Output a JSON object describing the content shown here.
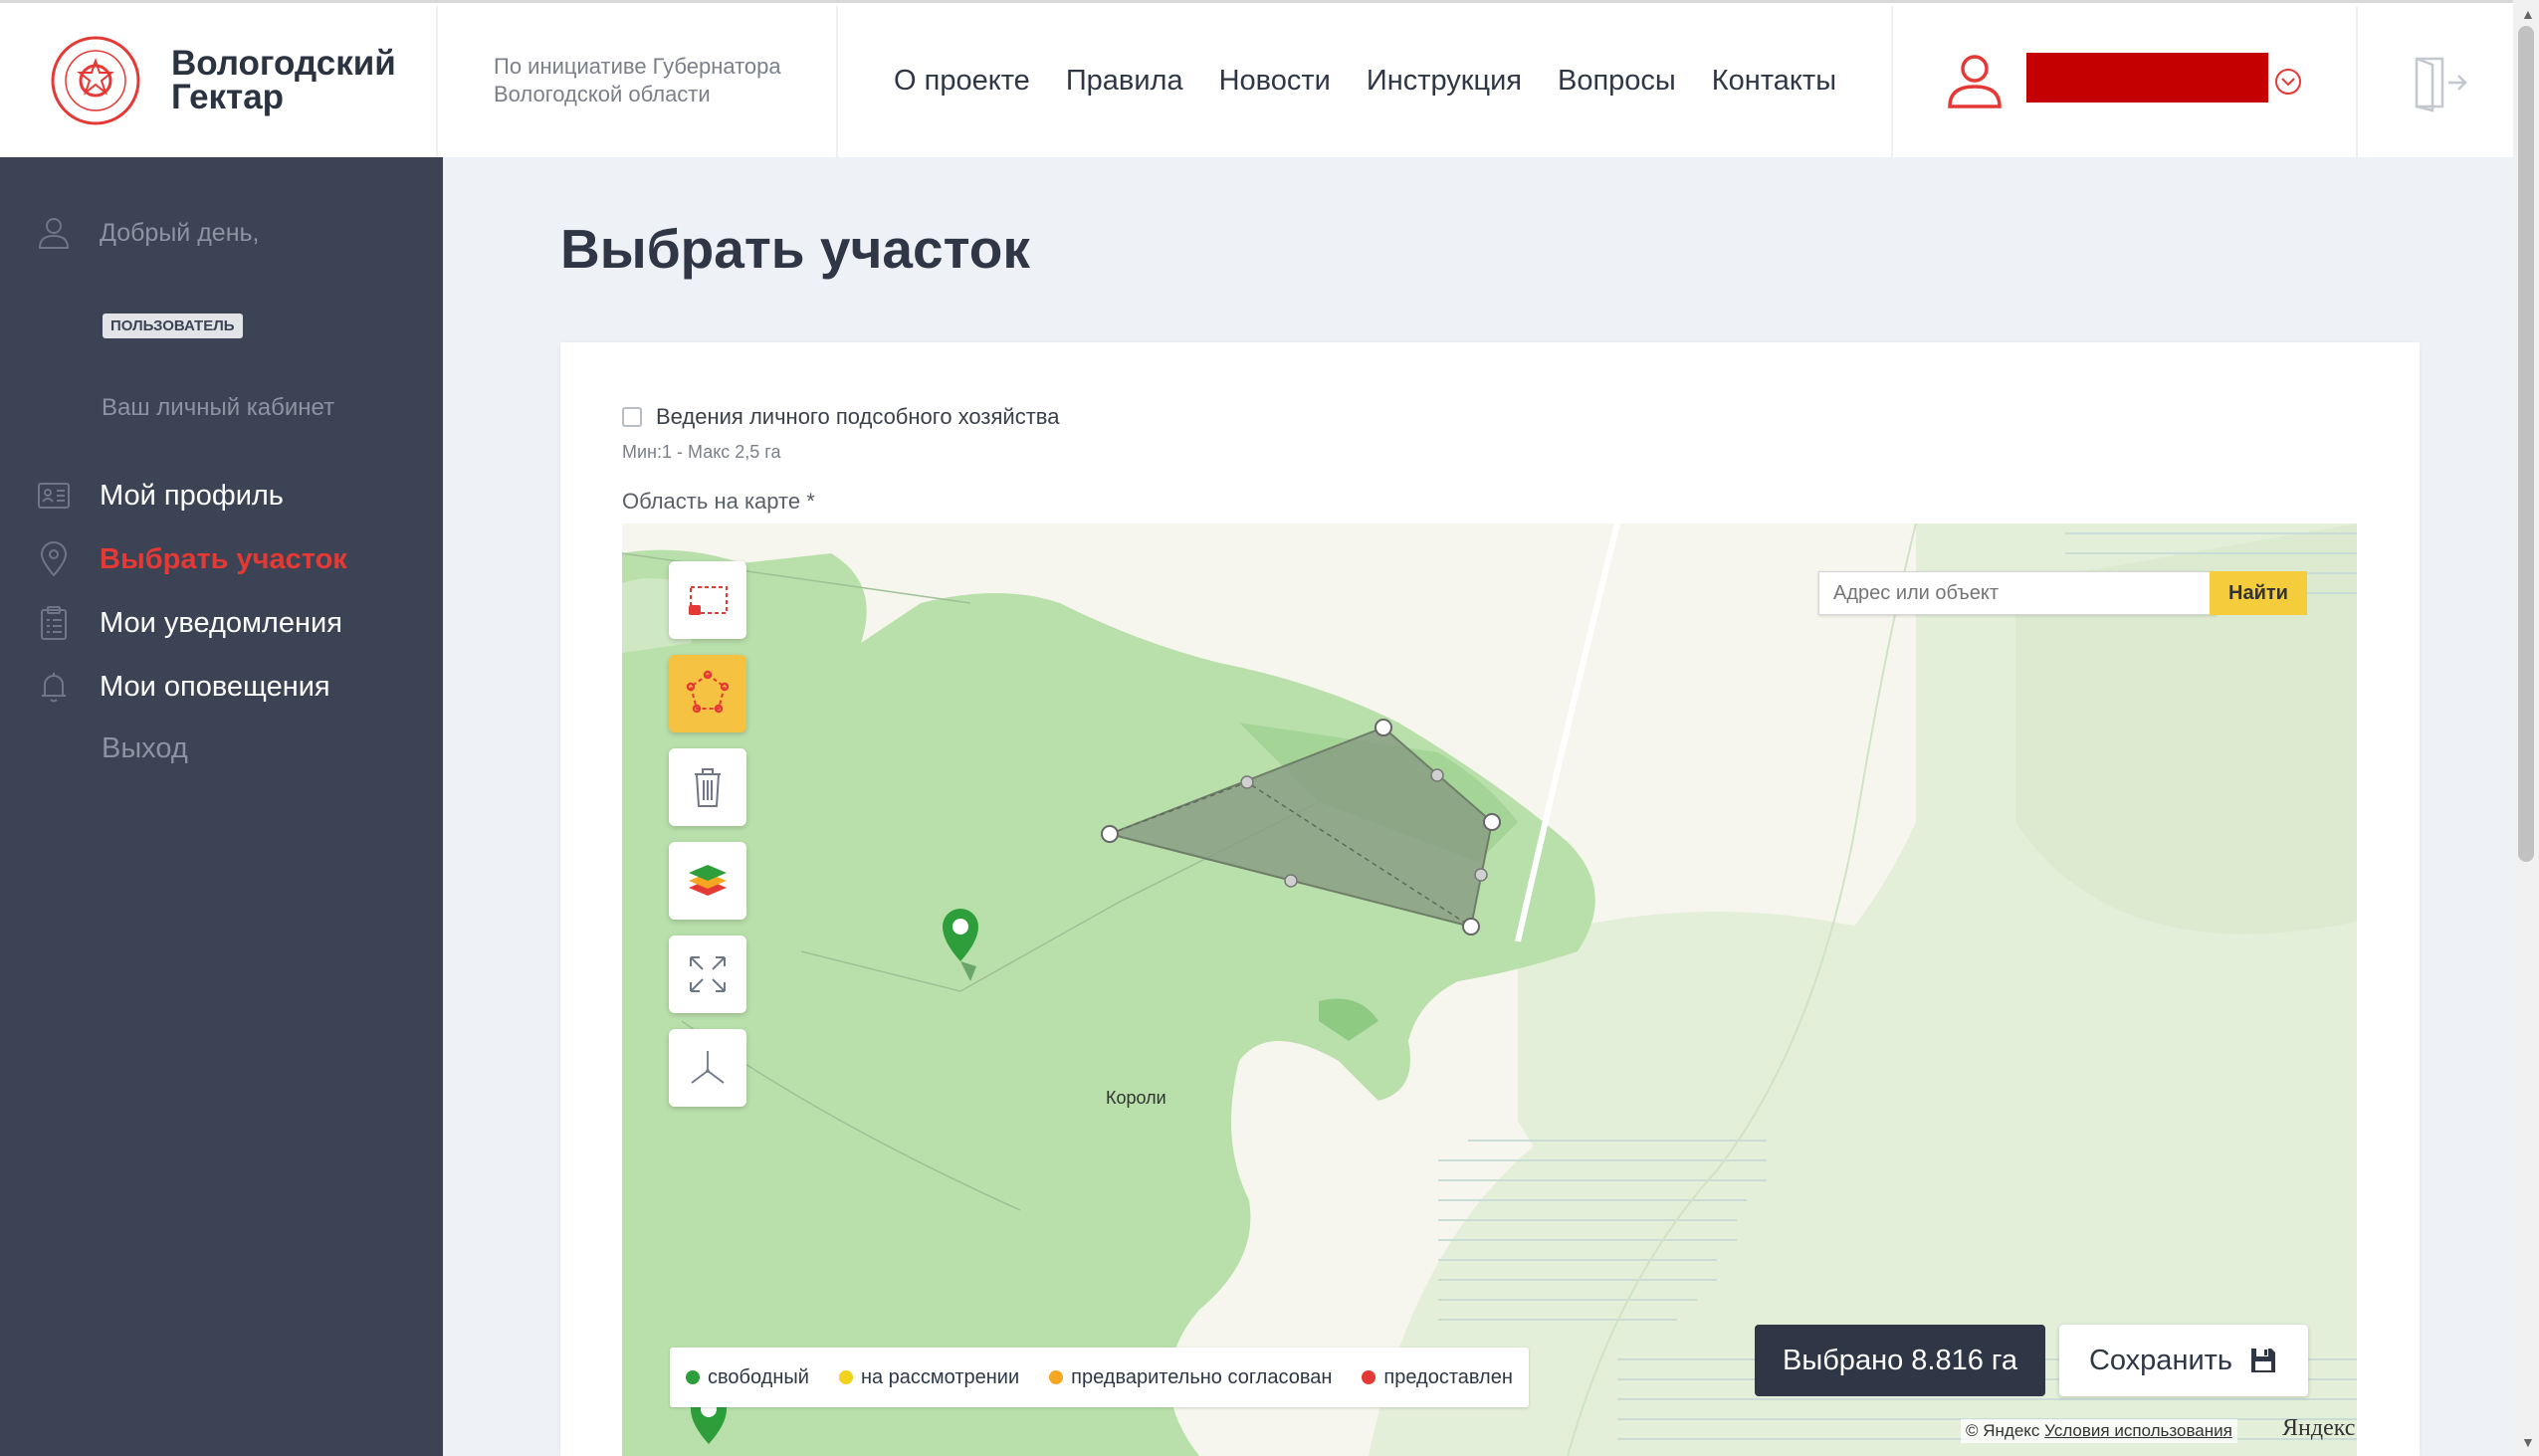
{
  "header": {
    "brand_line1": "Вологодский",
    "brand_line2": "Гектар",
    "initiative_line1": "По инициативе Губернатора",
    "initiative_line2": "Вологодской области",
    "nav": [
      "О проекте",
      "Правила",
      "Новости",
      "Инструкция",
      "Вопросы",
      "Контакты"
    ]
  },
  "sidebar": {
    "greeting": "Добрый день,",
    "role": "ПОЛЬЗОВАТЕЛЬ",
    "cabinet": "Ваш личный кабинет",
    "items": [
      {
        "label": "Мой профиль",
        "icon": "profile-card-icon"
      },
      {
        "label": "Выбрать участок",
        "icon": "map-pin-icon",
        "active": true
      },
      {
        "label": "Мои уведомления",
        "icon": "clipboard-list-icon"
      },
      {
        "label": "Мои оповещения",
        "icon": "bell-icon"
      },
      {
        "label": "Выход"
      }
    ]
  },
  "main": {
    "title": "Выбрать участок",
    "purpose_label": "Ведения личного подсобного хозяйства",
    "area_hint": "Мин:1 - Макс 2,5 га",
    "map_label": "Область на карте *"
  },
  "map": {
    "search_placeholder": "Адрес или объект",
    "search_button": "Найти",
    "place_label": "Короли",
    "legend": [
      {
        "label": "свободный",
        "color": "#2e9e3a"
      },
      {
        "label": "на рассмотрении",
        "color": "#f2d21c"
      },
      {
        "label": "предварительно согласован",
        "color": "#f5a623"
      },
      {
        "label": "предоставлен",
        "color": "#e53935"
      }
    ],
    "selected_label": "Выбрано 8.816 га",
    "save_label": "Сохранить",
    "copyright_prefix": "© Яндекс",
    "terms_link": "Условия использования",
    "provider_logo": "Яндекс"
  },
  "colors": {
    "accent": "#e53935",
    "sidebar_bg": "#3c4354",
    "map_land": "#b8dfa9",
    "highlight": "#f5cd3c"
  }
}
